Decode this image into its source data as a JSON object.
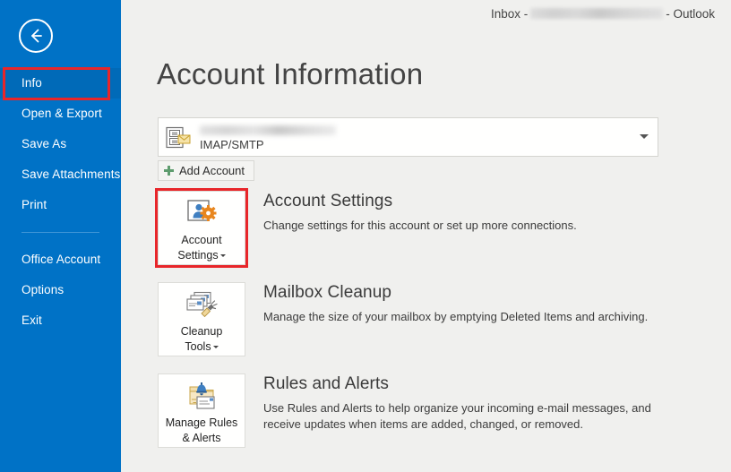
{
  "window": {
    "title_prefix": "Inbox -",
    "title_suffix": "- Outlook",
    "account_redacted": true
  },
  "sidebar": {
    "back_icon": "back-arrow-icon",
    "accent_color": "#0072c6",
    "selected_color": "#006ab8",
    "items": [
      {
        "label": "Info",
        "selected": true
      },
      {
        "label": "Open & Export",
        "selected": false
      },
      {
        "label": "Save As",
        "selected": false
      },
      {
        "label": "Save Attachments",
        "selected": false
      },
      {
        "label": "Print",
        "selected": false
      },
      {
        "label": "Office Account",
        "selected": false
      },
      {
        "label": "Options",
        "selected": false
      },
      {
        "label": "Exit",
        "selected": false
      }
    ]
  },
  "highlights": {
    "color": "#e8262a",
    "targets": [
      "sidebar-item-info",
      "account-settings-button"
    ]
  },
  "main": {
    "page_title": "Account Information",
    "account_selector": {
      "icon": "imap-account-icon",
      "name_redacted": true,
      "account_type": "IMAP/SMTP",
      "chevron_icon": "chevron-down-icon"
    },
    "add_account": {
      "label": "Add Account",
      "icon": "plus-icon",
      "icon_color": "#5e9c6e"
    },
    "features": [
      {
        "button_label_line1": "Account",
        "button_label_line2": "Settings",
        "has_caret": true,
        "icon": "account-settings-icon",
        "title": "Account Settings",
        "description": "Change settings for this account or set up more connections."
      },
      {
        "button_label_line1": "Cleanup",
        "button_label_line2": "Tools",
        "has_caret": true,
        "icon": "cleanup-tools-icon",
        "title": "Mailbox Cleanup",
        "description": "Manage the size of your mailbox by emptying Deleted Items and archiving."
      },
      {
        "button_label_line1": "Manage Rules",
        "button_label_line2": "& Alerts",
        "has_caret": false,
        "icon": "manage-rules-alerts-icon",
        "title": "Rules and Alerts",
        "description": "Use Rules and Alerts to help organize your incoming e-mail messages, and receive updates when items are added, changed, or removed."
      }
    ]
  }
}
